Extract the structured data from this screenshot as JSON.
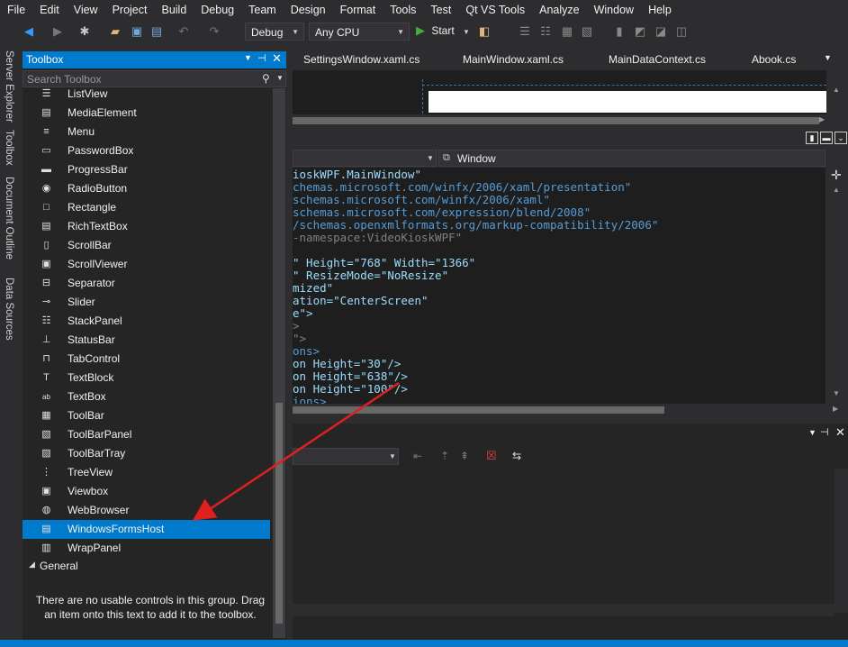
{
  "menu": [
    "File",
    "Edit",
    "View",
    "Project",
    "Build",
    "Debug",
    "Team",
    "Design",
    "Format",
    "Tools",
    "Test",
    "Qt VS Tools",
    "Analyze",
    "Window",
    "Help"
  ],
  "toolbar": {
    "config": "Debug",
    "platform": "Any CPU",
    "start_label": "Start"
  },
  "side_tabs": [
    "Server Explorer",
    "Toolbox",
    "Document Outline",
    "Data Sources"
  ],
  "toolbox": {
    "title": "Toolbox",
    "search_placeholder": "Search Toolbox",
    "items": [
      {
        "label": "ListView",
        "icon": "listview-icon"
      },
      {
        "label": "MediaElement",
        "icon": "media-icon"
      },
      {
        "label": "Menu",
        "icon": "menu-icon"
      },
      {
        "label": "PasswordBox",
        "icon": "password-icon"
      },
      {
        "label": "ProgressBar",
        "icon": "progressbar-icon"
      },
      {
        "label": "RadioButton",
        "icon": "radio-icon"
      },
      {
        "label": "Rectangle",
        "icon": "rectangle-icon"
      },
      {
        "label": "RichTextBox",
        "icon": "richtext-icon"
      },
      {
        "label": "ScrollBar",
        "icon": "scrollbar-icon"
      },
      {
        "label": "ScrollViewer",
        "icon": "scrollviewer-icon"
      },
      {
        "label": "Separator",
        "icon": "separator-icon"
      },
      {
        "label": "Slider",
        "icon": "slider-icon"
      },
      {
        "label": "StackPanel",
        "icon": "stackpanel-icon"
      },
      {
        "label": "StatusBar",
        "icon": "statusbar-icon"
      },
      {
        "label": "TabControl",
        "icon": "tabcontrol-icon"
      },
      {
        "label": "TextBlock",
        "icon": "textblock-icon"
      },
      {
        "label": "TextBox",
        "icon": "textbox-icon"
      },
      {
        "label": "ToolBar",
        "icon": "toolbar-icon"
      },
      {
        "label": "ToolBarPanel",
        "icon": "toolbarpanel-icon"
      },
      {
        "label": "ToolBarTray",
        "icon": "toolbartray-icon"
      },
      {
        "label": "TreeView",
        "icon": "treeview-icon"
      },
      {
        "label": "Viewbox",
        "icon": "viewbox-icon"
      },
      {
        "label": "WebBrowser",
        "icon": "webbrowser-icon"
      },
      {
        "label": "WindowsFormsHost",
        "icon": "windowsformshost-icon",
        "selected": true
      },
      {
        "label": "WrapPanel",
        "icon": "wrappanel-icon"
      }
    ],
    "group": "General",
    "empty_message_1": "There are no usable controls in this group. Drag",
    "empty_message_2": "an item onto this text to add it to the toolbox."
  },
  "doc_tabs": [
    "SettingsWindow.xaml.cs",
    "MainWindow.xaml.cs",
    "MainDataContext.cs",
    "Abook.cs"
  ],
  "editor": {
    "element_combo": "Window",
    "code_lines": [
      {
        "parts": [
          {
            "t": "ioskWPF.MainWindow\"",
            "c": "#9cdcfe"
          }
        ]
      },
      {
        "parts": [
          {
            "t": "chemas.microsoft.com/winfx/2006/xaml/presentation\"",
            "c": "#569cd6"
          }
        ]
      },
      {
        "parts": [
          {
            "t": "schemas.microsoft.com/winfx/2006/xaml\"",
            "c": "#569cd6"
          }
        ]
      },
      {
        "parts": [
          {
            "t": "schemas.microsoft.com/expression/blend/2008\"",
            "c": "#569cd6"
          }
        ]
      },
      {
        "parts": [
          {
            "t": "/schemas.openxmlformats.org/markup-compatibility/2006\"",
            "c": "#569cd6"
          }
        ]
      },
      {
        "parts": [
          {
            "t": "-namespace:VideoKioskWPF\"",
            "c": "#808080"
          }
        ]
      },
      {
        "parts": [
          {
            "t": "",
            "c": "#9cdcfe"
          }
        ]
      },
      {
        "parts": [
          {
            "t": "\" Height=\"768\" Width=\"1366\"",
            "c": "#9cdcfe"
          }
        ]
      },
      {
        "parts": [
          {
            "t": "\" ResizeMode=\"NoResize\"",
            "c": "#9cdcfe"
          }
        ]
      },
      {
        "parts": [
          {
            "t": "mized\"",
            "c": "#9cdcfe"
          }
        ]
      },
      {
        "parts": [
          {
            "t": "ation=\"CenterScreen\"",
            "c": "#9cdcfe"
          }
        ]
      },
      {
        "parts": [
          {
            "t": "e\">",
            "c": "#9cdcfe"
          }
        ]
      },
      {
        "parts": [
          {
            "t": ">",
            "c": "#808080"
          }
        ]
      },
      {
        "parts": [
          {
            "t": "\">",
            "c": "#808080"
          }
        ]
      },
      {
        "parts": [
          {
            "t": "ons>",
            "c": "#569cd6"
          }
        ]
      },
      {
        "parts": [
          {
            "t": "on Height=\"30\"/>",
            "c": "#9cdcfe"
          }
        ]
      },
      {
        "parts": [
          {
            "t": "on Height=\"638\"/>",
            "c": "#9cdcfe"
          }
        ]
      },
      {
        "parts": [
          {
            "t": "on Height=\"100\"/>",
            "c": "#9cdcfe"
          }
        ]
      },
      {
        "parts": [
          {
            "t": "ions>",
            "c": "#569cd6"
          }
        ]
      }
    ]
  },
  "colors": {
    "accent": "#007acc",
    "annotation_arrow": "#e0201c"
  }
}
